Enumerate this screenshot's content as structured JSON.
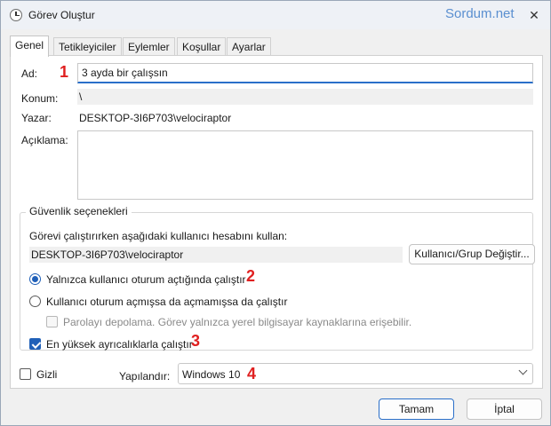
{
  "window": {
    "title": "Görev Oluştur",
    "watermark": "Sordum.net",
    "close_glyph": "✕"
  },
  "tabs": [
    {
      "label": "Genel",
      "active": true
    },
    {
      "label": "Tetikleyiciler",
      "active": false
    },
    {
      "label": "Eylemler",
      "active": false
    },
    {
      "label": "Koşullar",
      "active": false
    },
    {
      "label": "Ayarlar",
      "active": false
    }
  ],
  "general": {
    "name_label": "Ad:",
    "name_value": "3 ayda bir çalışsın",
    "location_label": "Konum:",
    "location_value": "\\",
    "author_label": "Yazar:",
    "author_value": "DESKTOP-3I6P703\\velociraptor",
    "description_label": "Açıklama:",
    "description_value": ""
  },
  "security": {
    "group_title": "Güvenlik seçenekleri",
    "run_as_text": "Görevi çalıştırırken aşağıdaki kullanıcı hesabını kullan:",
    "user_account": "DESKTOP-3I6P703\\velociraptor",
    "change_user_button": "Kullanıcı/Grup Değiştir...",
    "radio_logged_on": "Yalnızca kullanıcı oturum açtığında çalıştır",
    "radio_logged_on_checked": true,
    "radio_whether": "Kullanıcı oturum açmışsa da açmamışsa da çalıştır",
    "radio_whether_checked": false,
    "no_store_password": "Parolayı depolama. Görev yalnızca yerel bilgisayar kaynaklarına erişebilir.",
    "no_store_password_checked": false,
    "highest_privileges": "En yüksek ayrıcalıklarla çalıştır",
    "highest_privileges_checked": true
  },
  "bottom": {
    "hidden_label": "Gizli",
    "hidden_checked": false,
    "configure_label": "Yapılandır:",
    "configure_value": "Windows 10"
  },
  "buttons": {
    "ok": "Tamam",
    "cancel": "İptal"
  },
  "markers": {
    "m1": "1",
    "m2": "2",
    "m3": "3",
    "m4": "4"
  },
  "colors": {
    "accent": "#2060b8",
    "marker": "#e02020",
    "watermark": "#5a8fd0"
  }
}
